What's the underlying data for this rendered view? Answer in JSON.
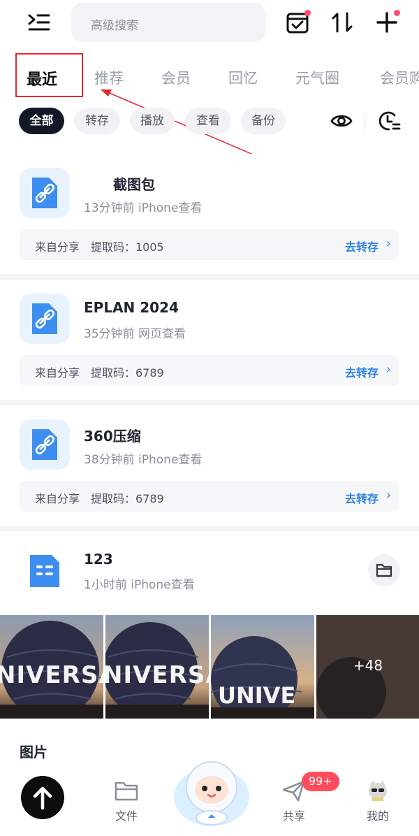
{
  "search": {
    "placeholder": "高级搜索"
  },
  "tabs": [
    {
      "label": "最近"
    },
    {
      "label": "推荐"
    },
    {
      "label": "会员"
    },
    {
      "label": "回忆"
    },
    {
      "label": "元气圈"
    },
    {
      "label": "会员购"
    }
  ],
  "filters": [
    {
      "label": "全部"
    },
    {
      "label": "转存"
    },
    {
      "label": "播放"
    },
    {
      "label": "查看"
    },
    {
      "label": "备份"
    }
  ],
  "cards": [
    {
      "name": "截图包",
      "meta": "13分钟前 iPhone查看",
      "share_from": "来自分享",
      "share_code": "提取码：1005",
      "action": "去转存"
    },
    {
      "name": "EPLAN 2024",
      "meta": "35分钟前 网页查看",
      "share_from": "来自分享",
      "share_code": "提取码：6789",
      "action": "去转存"
    },
    {
      "name": "360压缩",
      "meta": "38分钟前 iPhone查看",
      "share_from": "来自分享",
      "share_code": "提取码：6789",
      "action": "去转存"
    }
  ],
  "folder_card": {
    "name": "123",
    "meta": "1小时前 iPhone查看"
  },
  "photos": {
    "captions": [
      "NIVERSA",
      "NIVERSA",
      "UNIVE"
    ],
    "more": "+48"
  },
  "section_title": "图片",
  "bottom_nav": {
    "files": "文件",
    "share": "共享",
    "mine": "我的",
    "share_badge": "99+"
  },
  "colors": {
    "accent_blue": "#2f83e6",
    "highlight_red": "#e5272c",
    "badge_red": "#ff4d5e",
    "active_chip": "#121826"
  }
}
